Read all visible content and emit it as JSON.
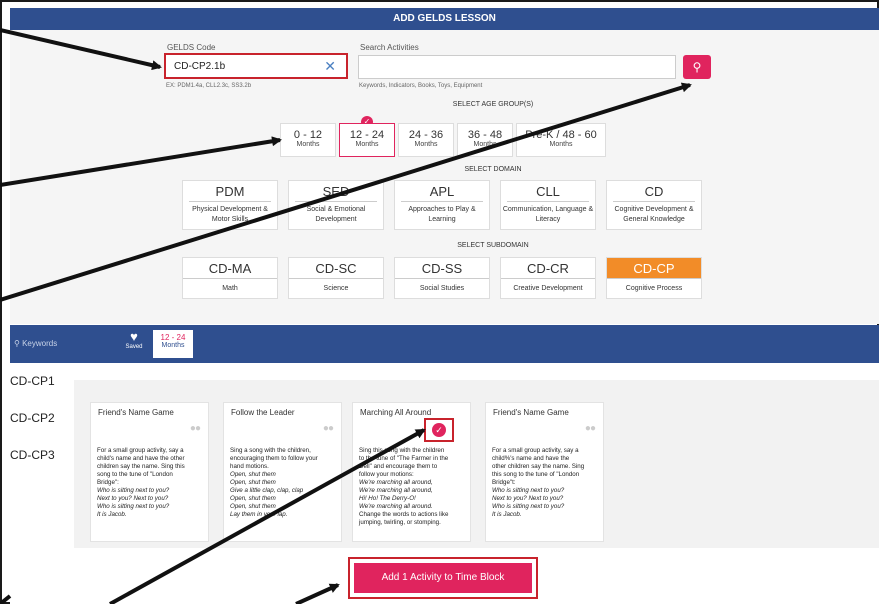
{
  "header": {
    "title": "ADD GELDS LESSON"
  },
  "gelds": {
    "label": "GELDS Code",
    "value": "CD-CP2.1b",
    "hint": "EX: PDM1.4a, CLL2.3c, SS3.2b"
  },
  "search": {
    "label": "Search Activities",
    "placeholder": "",
    "hint": "Keywords, Indicators, Books, Toys, Equipment"
  },
  "age_groups": {
    "title": "SELECT AGE GROUP(S)",
    "items": [
      {
        "range": "0 - 12",
        "unit": "Months"
      },
      {
        "range": "12 - 24",
        "unit": "Months"
      },
      {
        "range": "24 - 36",
        "unit": "Months"
      },
      {
        "range": "36 - 48",
        "unit": "Months"
      },
      {
        "range": "Pre-K / 48 - 60",
        "unit": "Months"
      }
    ],
    "selected": "12 - 24"
  },
  "domains": {
    "title": "SELECT DOMAIN",
    "items": [
      {
        "code": "PDM",
        "name": "Physical Development & Motor Skills"
      },
      {
        "code": "SED",
        "name": "Social & Emotional Development"
      },
      {
        "code": "APL",
        "name": "Approaches to Play & Learning"
      },
      {
        "code": "CLL",
        "name": "Communication, Language & Literacy"
      },
      {
        "code": "CD",
        "name": "Cognitive Development & General Knowledge"
      }
    ]
  },
  "subdomains": {
    "title": "SELECT SUBDOMAIN",
    "items": [
      {
        "code": "CD-MA",
        "name": "Math"
      },
      {
        "code": "CD-SC",
        "name": "Science"
      },
      {
        "code": "CD-SS",
        "name": "Social Studies"
      },
      {
        "code": "CD-CR",
        "name": "Creative Development"
      },
      {
        "code": "CD-CP",
        "name": "Cognitive Process"
      }
    ],
    "selected": "CD-CP",
    "accent": "#f28c28"
  },
  "filterbar": {
    "keywords_placeholder": "Keywords",
    "saved_label": "Saved",
    "age_range": "12 - 24",
    "age_unit": "Months"
  },
  "side_items": [
    "CD-CP1",
    "CD-CP2",
    "CD-CP3"
  ],
  "cards": [
    {
      "title": "Friend's Name Game",
      "lines": [
        "For a small group activity, say a",
        "child's name and have the other",
        "children say the name. Sing this",
        "song to the tune of \"London",
        "Bridge\":"
      ],
      "italic": [
        "Who is sitting next to you?",
        "Next to you? Next to you?",
        "Who is sitting next to you?",
        "It is Jacob."
      ]
    },
    {
      "title": "Follow the Leader",
      "lines": [
        "Sing a song with the children,",
        "encouraging them to follow your",
        "hand motions."
      ],
      "italic": [
        "Open, shut them",
        "Open, shut them",
        "Give a little clap, clap, clap",
        "Open, shut them",
        "Open, shut them",
        "Lay them in your lap."
      ]
    },
    {
      "title": "Marching All Around",
      "lines": [
        "Sing this song with the children",
        "to the tune of \"The Farmer in the",
        "Dell\" and encourage them to",
        "follow your motions:"
      ],
      "italic": [
        "We're marching all around,",
        "We're marching all around,",
        "Hi! Ho! The Derry-O!",
        "We're marching all around."
      ],
      "after": [
        "Change the words to actions like",
        "jumping, twirling, or stomping."
      ]
    },
    {
      "title": "Friend's Name Game",
      "lines": [
        "For a small group activity, say a",
        "child%'s name and have the",
        "other children say the name. Sing",
        "this song to the tune of \"London",
        "Bridge\"t:"
      ],
      "italic": [
        "Who is sitting next to you?",
        "Next to you? Next to you?",
        "Who is sitting next to you?",
        "It is Jacob."
      ]
    }
  ],
  "add_button": {
    "label": "Add 1 Activity to Time Block"
  },
  "colors": {
    "primary_blue": "#2f4f8f",
    "accent_pink": "#e0245e",
    "highlight_red": "#c8232c"
  }
}
